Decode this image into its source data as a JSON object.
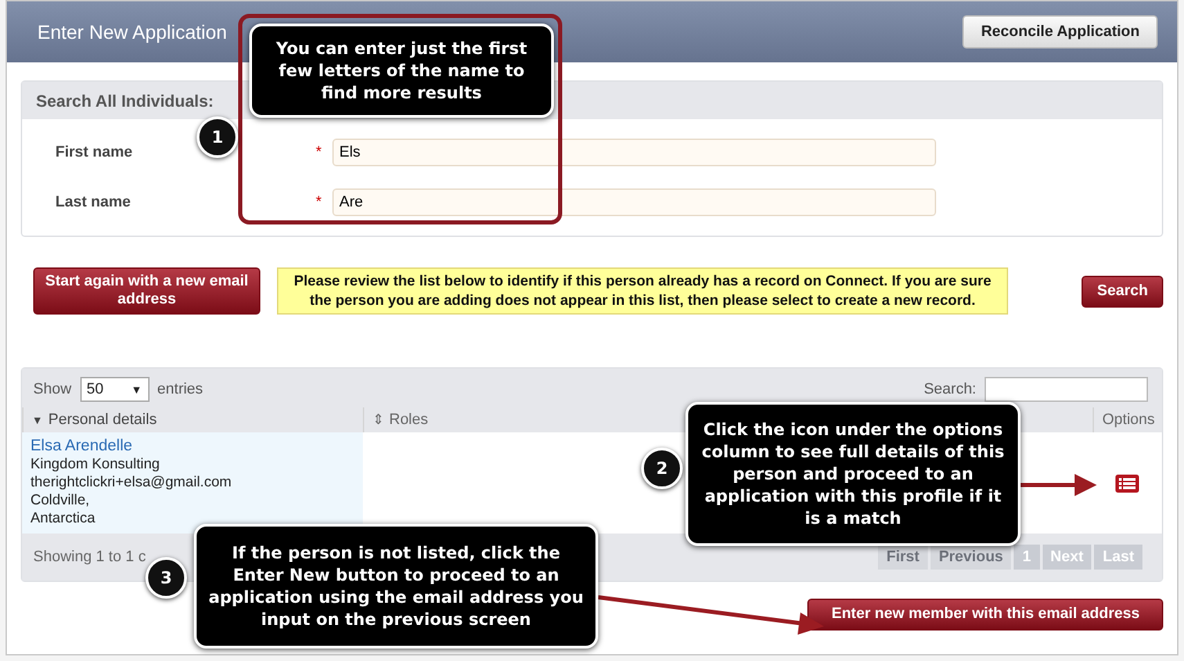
{
  "header": {
    "title": "Enter New Application",
    "button": "Reconcile Application"
  },
  "search_panel": {
    "title": "Search All Individuals:",
    "fields": [
      {
        "label": "First name",
        "required_mark": "*",
        "value": "Els"
      },
      {
        "label": "Last name",
        "required_mark": "*",
        "value": "Are"
      }
    ]
  },
  "actions": {
    "start_again": "Start again with a new email address",
    "notice": "Please review the list below to identify if this person already has a record on Connect. If you are sure the person you are adding does not appear in this list, then please select to create a new record.",
    "search": "Search"
  },
  "table": {
    "show_label": "Show",
    "page_size": "50",
    "select_arrow": "▼",
    "entries_label": "entries",
    "search_label": "Search:",
    "columns": [
      {
        "label": "Personal details",
        "sort_icon": "▼",
        "sorted": true
      },
      {
        "label": "Roles",
        "sort_icon": "⇕",
        "sorted": false
      },
      {
        "label": "Options",
        "sorted": false
      }
    ],
    "rows": [
      {
        "name": "Elsa Arendelle",
        "lines": [
          "Kingdom Konsulting",
          "therightclickri+elsa@gmail.com",
          "Coldville,",
          "Antarctica"
        ]
      }
    ],
    "info": "Showing 1 to 1 c",
    "pagination": [
      {
        "label": "First",
        "disabled": true
      },
      {
        "label": "Previous",
        "disabled": true
      },
      {
        "label": "1",
        "disabled": false
      },
      {
        "label": "Next",
        "disabled": false
      },
      {
        "label": "Last",
        "disabled": false
      }
    ]
  },
  "enter_new": "Enter new member with this email address",
  "callouts": [
    {
      "number": "1",
      "text": "You can enter just the first few letters of the name to find more results"
    },
    {
      "number": "2",
      "text": "Click the icon under the options column to see full details of this person and proceed to an application with this profile if it is a match"
    },
    {
      "number": "3",
      "text": "If the person is not listed, click the Enter New button to proceed to an application using the email address you input on the previous screen"
    }
  ]
}
